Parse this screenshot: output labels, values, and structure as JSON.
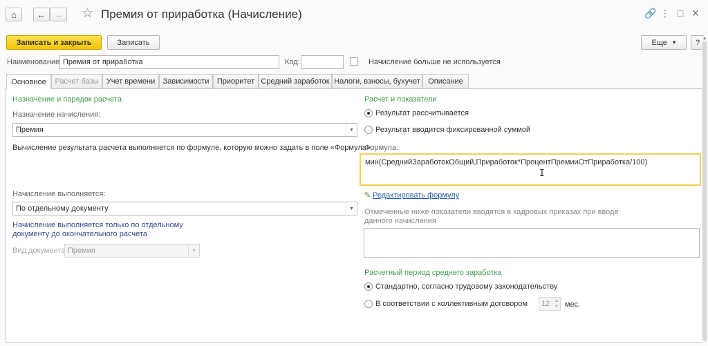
{
  "window": {
    "title": "Премия от приработка (Начисление)",
    "menu_icon": "⋮",
    "link_icon": "🔗",
    "maximize_icon": "□",
    "close_icon": "✕"
  },
  "toolbar": {
    "save_close": "Записать и закрыть",
    "save": "Записать",
    "more": "Еще",
    "more_arrow": "▾",
    "help": "?"
  },
  "header_fields": {
    "name_label": "Наименование:",
    "name_value": "Премия от приработка",
    "code_label": "Код:",
    "code_value": "",
    "inactive_label": "Начисление больше не используется"
  },
  "tabs": [
    {
      "label": "Основное"
    },
    {
      "label": "Расчет базы"
    },
    {
      "label": "Учет времени"
    },
    {
      "label": "Зависимости"
    },
    {
      "label": "Приоритет"
    },
    {
      "label": "Средний заработок"
    },
    {
      "label": "Налоги, взносы, бухучет"
    },
    {
      "label": "Описание"
    }
  ],
  "left": {
    "section_title": "Назначение и порядок расчета",
    "purpose_label": "Назначение начисления:",
    "purpose_value": "Премия",
    "formula_note": "Вычисление результата расчета выполняется по формуле, которую можно задать в поле «Формула».",
    "performed_label": "Начисление выполняется:",
    "performed_value": "По отдельному документу",
    "performed_note_1": "Начисление выполняется только по отдельному",
    "performed_note_2": "документу до окончательного расчета",
    "doc_type_label": "Вид документа:",
    "doc_type_value": "Премия"
  },
  "right": {
    "section_title": "Расчет и показатели",
    "radio_calculated": "Результат рассчитывается",
    "radio_fixed": "Результат вводится фиксированной суммой",
    "formula_label": "Формула:",
    "formula_value": "мин(СреднийЗаработокОбщий,Приработок*ПроцентПремииОтПриработка/100)",
    "edit_formula": "Редактировать формулу",
    "indicators_note_1": "Отмеченные ниже показатели вводятся в кадровых приказах при вводе",
    "indicators_note_2": "данного начисления",
    "period_title": "Расчетный период среднего заработка",
    "radio_standard": "Стандартно, согласно трудовому законодательству",
    "radio_collective": "В соответствии с коллективным договором",
    "months_value": "12",
    "months_unit": "мес."
  }
}
